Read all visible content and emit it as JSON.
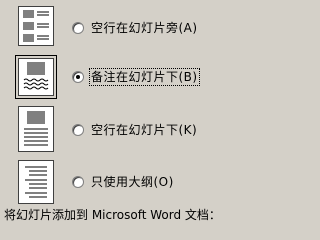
{
  "layout_options": [
    {
      "label": "空行在幻灯片旁(A)",
      "checked": false,
      "icon": "notes-beside-slides-icon"
    },
    {
      "label": "备注在幻灯片下(B)",
      "checked": true,
      "icon": "notes-below-slides-icon"
    },
    {
      "label": "空行在幻灯片下(K)",
      "checked": false,
      "icon": "blank-lines-below-slides-icon"
    },
    {
      "label": "只使用大纲(O)",
      "checked": false,
      "icon": "outline-only-icon"
    }
  ],
  "bottom_text": "将幻灯片添加到 Microsoft Word 文档："
}
